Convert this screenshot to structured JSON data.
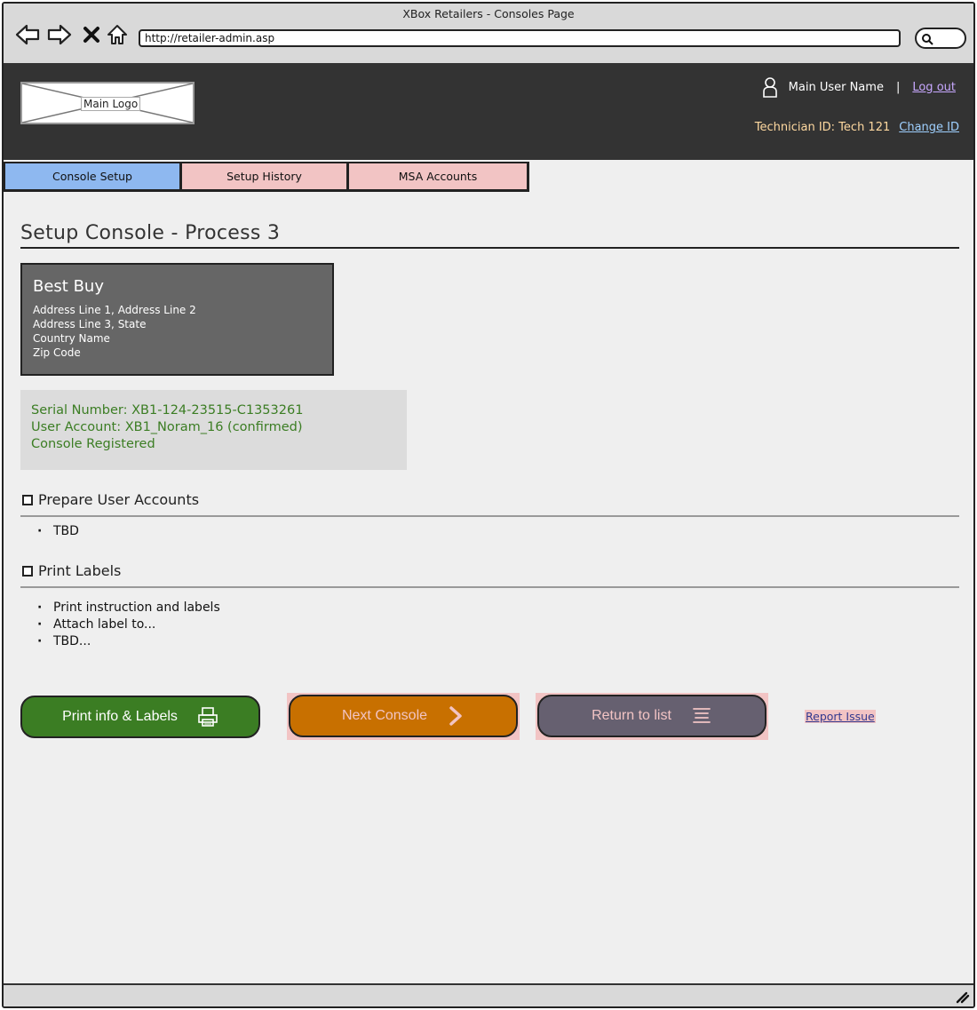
{
  "window": {
    "title": "XBox Retailers - Consoles Page"
  },
  "browser": {
    "url": "http://retailer-admin.asp"
  },
  "header": {
    "logo_label": "Main Logo",
    "user_name": "Main User Name",
    "separator": "|",
    "logout_label": "Log out",
    "technician_text": "Technician ID: Tech 121",
    "change_id_label": "Change ID"
  },
  "tabs": [
    {
      "label": "Console Setup",
      "active": true
    },
    {
      "label": "Setup History",
      "active": false
    },
    {
      "label": "MSA Accounts",
      "active": false
    }
  ],
  "page_title": "Setup Console - Process 3",
  "store": {
    "name": "Best Buy",
    "lines": [
      "Address Line 1, Address Line 2",
      "Address Line 3, State",
      "Country Name",
      "Zip Code"
    ]
  },
  "status": {
    "serial": "Serial Number: XB1-124-23515-C1353261",
    "account": "User Account: XB1_Noram_16 (confirmed)",
    "registered": "Console Registered"
  },
  "sections": [
    {
      "title": "Prepare User Accounts",
      "items": [
        "TBD"
      ]
    },
    {
      "title": "Print Labels",
      "items": [
        "Print instruction and labels",
        "Attach label to...",
        "TBD..."
      ]
    }
  ],
  "buttons": {
    "print": "Print info & Labels",
    "next": "Next Console",
    "return": "Return to list"
  },
  "report_link": "Report Issue",
  "icons": {
    "back": "arrow-left-icon",
    "forward": "arrow-right-icon",
    "stop": "close-icon",
    "home": "home-icon",
    "search": "search-icon",
    "user": "user-icon",
    "printer": "printer-icon",
    "chevron": "chevron-right-icon",
    "list": "list-icon",
    "resize": "resize-grip-icon"
  },
  "colors": {
    "header_bg": "#333333",
    "tab_active": "#8eb8f0",
    "tab_inactive": "#f2c4c4",
    "store_card": "#666666",
    "status_text": "#3b7d23",
    "btn_print": "#3b7d23",
    "btn_next": "#c87000",
    "btn_return": "#666070"
  }
}
